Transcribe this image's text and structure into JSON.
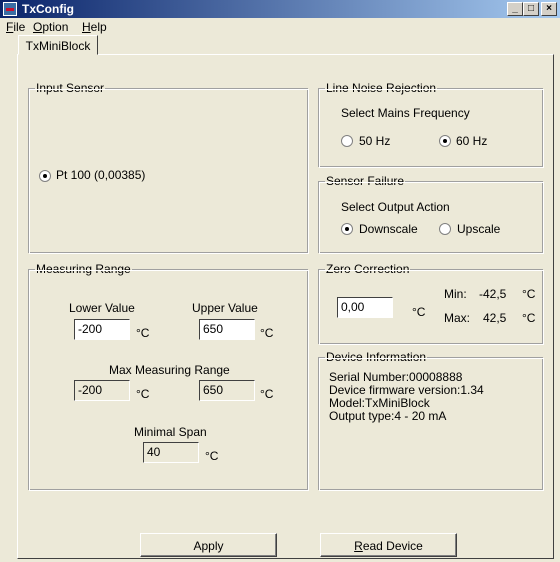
{
  "window": {
    "title": "TxConfig",
    "controls": {
      "minimize": "_",
      "maximize": "□",
      "close": "×"
    }
  },
  "menu": [
    "File",
    "Option",
    "Help"
  ],
  "tab": {
    "label": "TxMiniBlock"
  },
  "input_sensor": {
    "title": "Input Sensor",
    "option": "Pt 100 (0,00385)"
  },
  "line_noise": {
    "title": "Line Noise Rejection",
    "subtitle": "Select Mains Frequency",
    "opt_50": "50 Hz",
    "opt_60": "60 Hz",
    "selected": "60 Hz"
  },
  "sensor_failure": {
    "title": "Sensor Failure",
    "subtitle": "Select Output Action",
    "opt_down": "Downscale",
    "opt_up": "Upscale",
    "selected": "Downscale"
  },
  "measuring_range": {
    "title": "Measuring Range",
    "lower_label": "Lower Value",
    "lower_value": "-200",
    "upper_label": "Upper Value",
    "upper_value": "650",
    "max_label": "Max Measuring Range",
    "max_lower": "-200",
    "max_upper": "650",
    "min_span_label": "Minimal Span",
    "min_span": "40",
    "unit": "°C"
  },
  "zero_correction": {
    "title": "Zero Correction",
    "value": "0,00",
    "unit": "°C",
    "min_label": "Min:",
    "min_value": "-42,5",
    "max_label": "Max:",
    "max_value": "42,5"
  },
  "device_info": {
    "title": "Device Information",
    "serial": "Serial Number:00008888",
    "firmware": "Device firmware version:1.34",
    "model": "Model:TxMiniBlock",
    "output": "Output type:4 - 20 mA"
  },
  "buttons": {
    "apply": "Apply",
    "read_device": "Read Device"
  }
}
